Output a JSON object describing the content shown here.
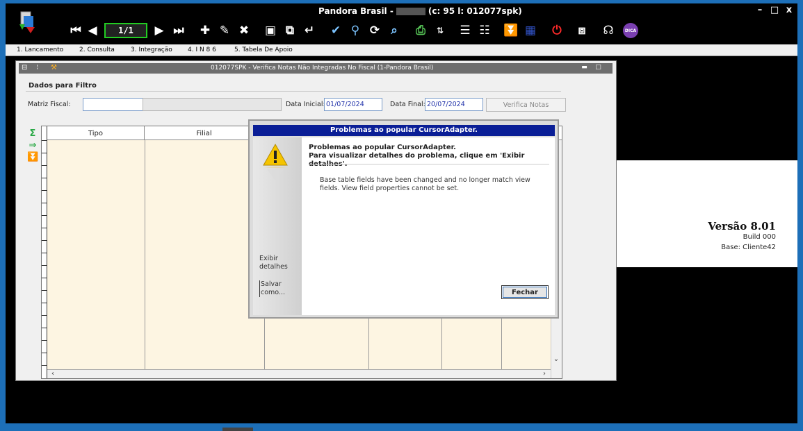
{
  "window": {
    "title_prefix": "Pandora Brasil -",
    "title_suffix": "(c: 95 l: 012077spk)",
    "minimize": "–",
    "restore": "□",
    "close": "x"
  },
  "toolbar": {
    "pager": "1/1",
    "icons": [
      "first-icon",
      "prev-icon",
      "next-icon",
      "last-icon",
      "add-icon",
      "edit-icon",
      "delete-icon",
      "save-icon",
      "copy-icon",
      "confirm-icon",
      "clear-icon",
      "search-icon",
      "refresh-icon",
      "preview-icon",
      "print-icon",
      "sort-icon",
      "list-add-icon",
      "list-icon",
      "download-icon",
      "database-icon",
      "power-icon",
      "remote-icon",
      "support-icon",
      "dica-icon"
    ],
    "dica_label": "DICA"
  },
  "menu": [
    "1. Lancamento",
    "2. Consulta",
    "3. Integração",
    "4. I N 8 6",
    "5. Tabela De Apoio"
  ],
  "child": {
    "title": "012077SPK - Verifica Notas Não Integradas No Fiscal (1-Pandora Brasil)",
    "filter_header": "Dados para Filtro",
    "matriz_label": "Matriz Fiscal:",
    "matriz_value": "",
    "data_inicial_label": "Data Inicial:",
    "data_inicial_value": "01/07/2024",
    "data_final_label": "Data Final:",
    "data_final_value": "20/07/2024",
    "verifica_button": "Verifica Notas",
    "grid_columns": [
      "Tipo",
      "Filial"
    ]
  },
  "version_panel": {
    "version": "Versão  8.01",
    "build": "Build 000",
    "base": "Base: Cliente42"
  },
  "dialog": {
    "title": "Problemas ao popular CursorAdapter.",
    "heading_line1": "Problemas ao popular CursorAdapter.",
    "heading_line2": "Para visualizar detalhes do problema, clique em 'Exibir detalhes'.",
    "body": "Base table fields have been changed and no longer match view fields. View field properties cannot be set.",
    "link_details": "Exibir detalhes",
    "link_save": "Salvar como...",
    "close_button": "Fechar"
  },
  "colors": {
    "frame": "#1d6fb8",
    "dialog_title": "#0a1e96",
    "accent_green": "#22cc22",
    "grid_bg": "#fdf5e2"
  }
}
